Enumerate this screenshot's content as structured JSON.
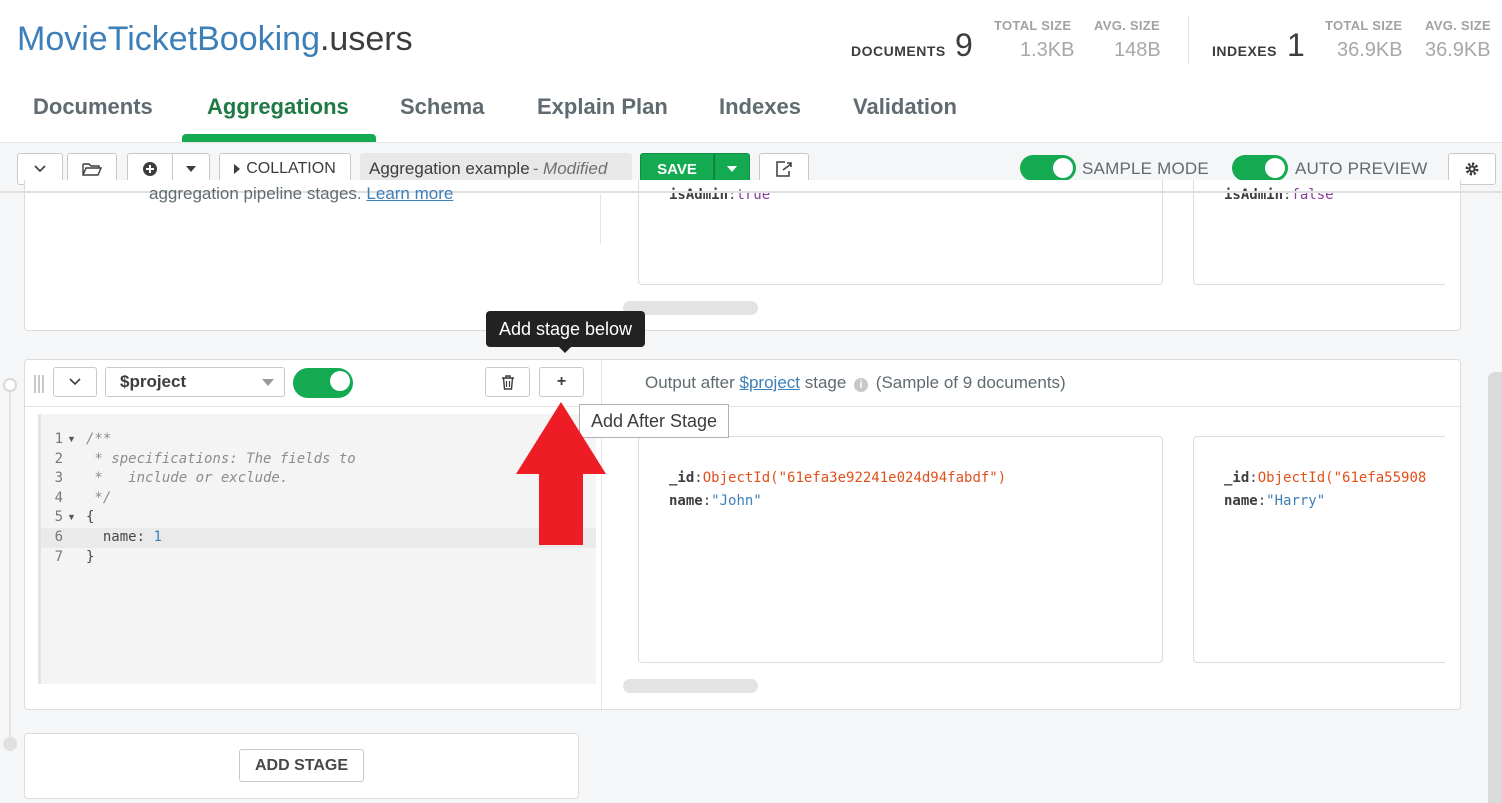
{
  "header": {
    "db_name": "MovieTicketBooking",
    "coll_name": ".users",
    "documents_label": "DOCUMENTS",
    "documents_count": "9",
    "total_size_label": "TOTAL SIZE",
    "total_size_value": "1.3KB",
    "avg_size_label": "AVG. SIZE",
    "avg_size_value": "148B",
    "indexes_label": "INDEXES",
    "indexes_count": "1",
    "idx_total_size_label": "TOTAL SIZE",
    "idx_total_size_value": "36.9KB",
    "idx_avg_size_label": "AVG. SIZE",
    "idx_avg_size_value": "36.9KB"
  },
  "tabs": [
    {
      "label": "Documents"
    },
    {
      "label": "Aggregations"
    },
    {
      "label": "Schema"
    },
    {
      "label": "Explain Plan"
    },
    {
      "label": "Indexes"
    },
    {
      "label": "Validation"
    }
  ],
  "toolbar": {
    "collation_label": "COLLATION",
    "pipeline_name": "Aggregation example",
    "modified_label": "- Modified",
    "save_label": "SAVE",
    "sample_mode_label": "SAMPLE MODE",
    "auto_preview_label": "AUTO PREVIEW"
  },
  "top_stage": {
    "description_text": "aggregation pipeline stages.",
    "learn_more": "Learn more",
    "doc1": {
      "key": "isAdmin",
      "value": "true"
    },
    "doc2": {
      "key": "isAdmin",
      "value": "false"
    }
  },
  "project_stage": {
    "operator": "$project",
    "output_prefix": "Output after",
    "output_stage_link": "$project",
    "output_suffix": "stage",
    "sample_text": "(Sample of 9 documents)",
    "code_lines": [
      {
        "n": "1",
        "text": "/**",
        "comment": true
      },
      {
        "n": "2",
        "text": " * specifications: The fields to",
        "comment": true
      },
      {
        "n": "3",
        "text": " *   include or exclude.",
        "comment": true
      },
      {
        "n": "4",
        "text": " */",
        "comment": true
      },
      {
        "n": "5",
        "text": "{",
        "comment": false
      },
      {
        "n": "6",
        "text": "  name: ",
        "value": "1",
        "comment": false
      },
      {
        "n": "7",
        "text": "}",
        "comment": false
      }
    ],
    "docs": [
      {
        "id_key": "_id",
        "id_value": "ObjectId(\"61efa3e92241e024d94fabdf\")",
        "name_key": "name",
        "name_value": "\"John\""
      },
      {
        "id_key": "_id",
        "id_value": "ObjectId(\"61efa55908",
        "name_key": "name",
        "name_value": "\"Harry\""
      }
    ]
  },
  "tooltips": {
    "add_stage_below": "Add stage below",
    "add_after_stage": "Add After Stage"
  },
  "add_stage_label": "ADD STAGE",
  "colors": {
    "accent_green": "#13aa52",
    "title_blue": "#3d7fb8",
    "arrow_red": "#ee1c25"
  }
}
